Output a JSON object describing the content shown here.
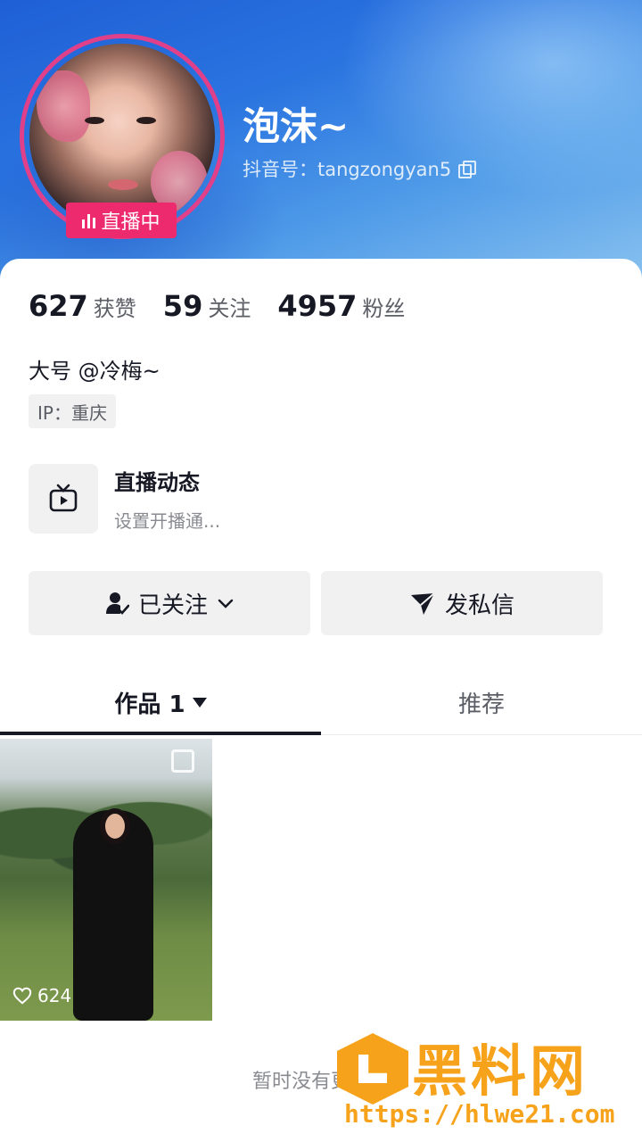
{
  "profile": {
    "name": "泡沫~",
    "douyin_id": "抖音号：tangzongyan5",
    "live_badge": "直播中"
  },
  "stats": [
    {
      "num": "627",
      "label": "获赞"
    },
    {
      "num": "59",
      "label": "关注"
    },
    {
      "num": "4957",
      "label": "粉丝"
    }
  ],
  "bio": "大号 @冷梅~",
  "ip": "IP：重庆",
  "live_feed": {
    "title": "直播动态",
    "subtitle": "设置开播通..."
  },
  "actions": {
    "follow_label": "已关注",
    "message_label": "发私信"
  },
  "tabs": {
    "works_label": "作品 1",
    "recommend_label": "推荐"
  },
  "videos": [
    {
      "likes": "624"
    }
  ],
  "footer_text": "暂时没有更多了",
  "watermark": {
    "title": "黑料网",
    "url": "https://hlwe21.com"
  },
  "colors": {
    "live_pink": "#ee2a6e",
    "header_blue": "#2a74e0",
    "watermark_orange": "#f7a21b"
  }
}
